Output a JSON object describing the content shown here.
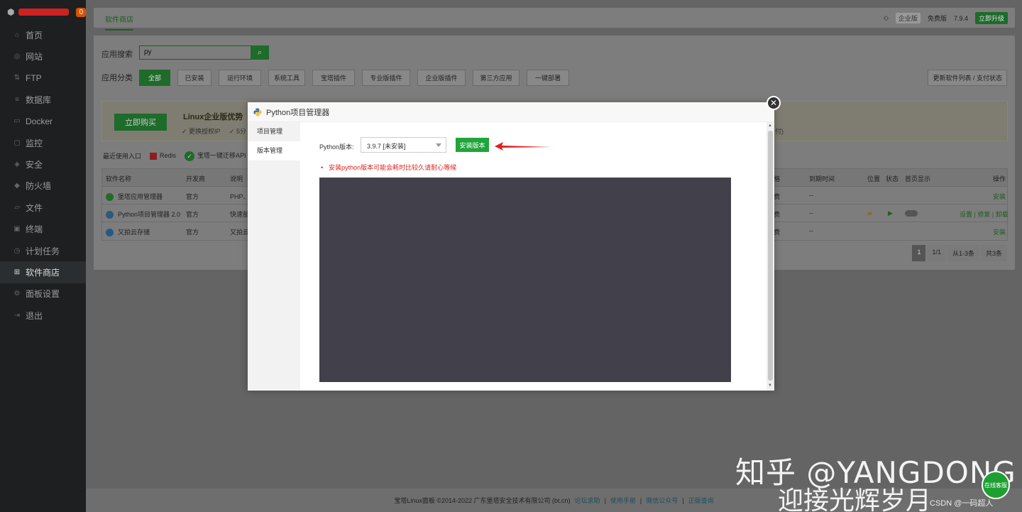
{
  "sidebar": {
    "badge": "0",
    "items": [
      {
        "label": "首页",
        "icon": "home-icon"
      },
      {
        "label": "网站",
        "icon": "globe-icon"
      },
      {
        "label": "FTP",
        "icon": "ftp-icon"
      },
      {
        "label": "数据库",
        "icon": "database-icon"
      },
      {
        "label": "Docker",
        "icon": "docker-icon"
      },
      {
        "label": "监控",
        "icon": "monitor-icon"
      },
      {
        "label": "安全",
        "icon": "shield-icon"
      },
      {
        "label": "防火墙",
        "icon": "firewall-icon"
      },
      {
        "label": "文件",
        "icon": "folder-icon"
      },
      {
        "label": "终端",
        "icon": "terminal-icon"
      },
      {
        "label": "计划任务",
        "icon": "clock-icon"
      },
      {
        "label": "软件商店",
        "icon": "grid-icon"
      },
      {
        "label": "面板设置",
        "icon": "gear-icon"
      },
      {
        "label": "退出",
        "icon": "logout-icon"
      }
    ]
  },
  "topbar": {
    "tab": "软件商店",
    "enterprise": "企业版",
    "edition": "免费版",
    "version": "7.9.4",
    "upgrade": "立即升级"
  },
  "search": {
    "label": "应用搜索",
    "value": "py"
  },
  "categories": {
    "label": "应用分类",
    "items": [
      "全部",
      "已安装",
      "运行环境",
      "系统工具",
      "宝塔插件",
      "专业版插件",
      "企业版插件",
      "第三方应用",
      "一键部署"
    ],
    "refresh": "更新软件列表 / 支付状态"
  },
  "promo": {
    "buy": "立即购买",
    "title": "Linux企业版优势",
    "feat1": "✓ 更换授权IP",
    "feat2": "✓ 5分",
    "tail": "付)"
  },
  "recent": {
    "label": "最近使用入口",
    "redis": "Redis",
    "migrate": "宝塔一键迁移API"
  },
  "table": {
    "headers": {
      "name": "软件名称",
      "dev": "开发商",
      "desc": "说明",
      "price": "格",
      "expire": "到期时间",
      "pos": "位置",
      "status": "状态",
      "home": "首页显示",
      "ops": "操作"
    },
    "rows": [
      {
        "name": "堡塔应用管理器",
        "dev": "官方",
        "desc": "PHP、",
        "price": "费",
        "expire": "--",
        "ops": "安装"
      },
      {
        "name": "Python项目管理器 2.0",
        "dev": "官方",
        "desc": "快速部",
        "price": "费",
        "expire": "--",
        "ops1": "设置",
        "ops2": "修复",
        "ops3": "卸载"
      },
      {
        "name": "又拍云存储",
        "dev": "官方",
        "desc": "又拍云",
        "price": "费",
        "expire": "--",
        "ops": "安装"
      }
    ]
  },
  "pager": {
    "current": "1",
    "pages": "1/1",
    "range": "从1-3条",
    "total": "共3条"
  },
  "footer": {
    "copyright": "宝塔Linux面板 ©2014-2022 广东堡塔安全技术有限公司 (bt.cn)",
    "links": [
      "论坛求助",
      "使用手册",
      "微信公众号",
      "正版查询"
    ]
  },
  "modal": {
    "title": "Python项目管理器",
    "tabs": [
      "项目管理",
      "版本管理"
    ],
    "version_label": "Python版本:",
    "version_value": "3.9.7 [未安装]",
    "install": "安装版本",
    "warning": "安装python版本可能会耗时比较久请耐心等候"
  },
  "watermark": {
    "line1": "知乎 @YANGDONG",
    "line2": "迎接光辉岁月",
    "csdn": "CSDN @一码超人",
    "online": "在线客服"
  }
}
